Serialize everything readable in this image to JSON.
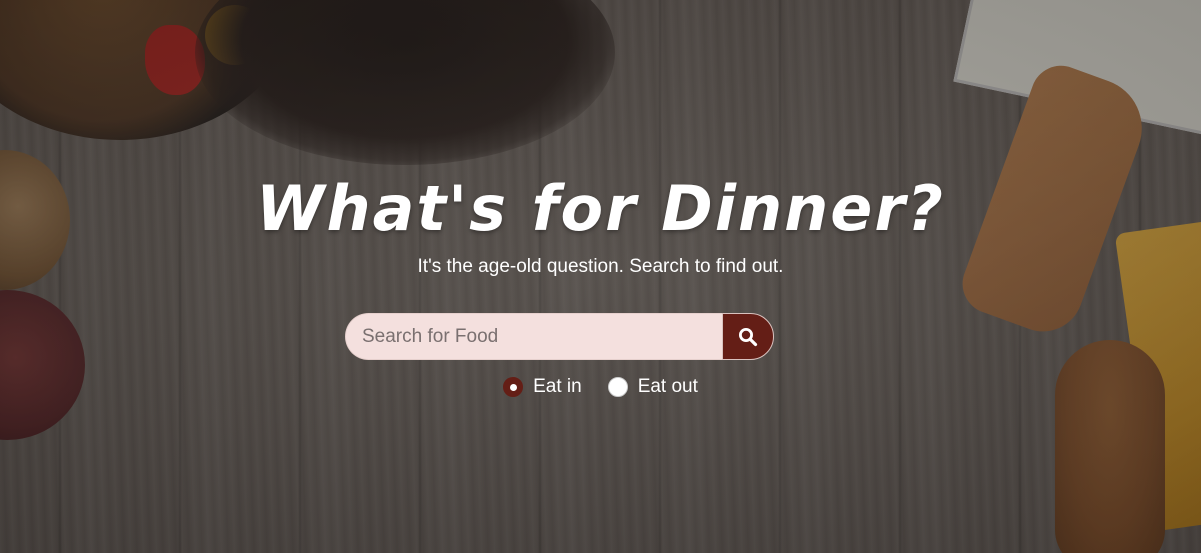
{
  "hero": {
    "title": "What's for Dinner?",
    "subtitle": "It's the age-old question. Search to find out."
  },
  "search": {
    "placeholder": "Search for Food",
    "value": "",
    "button_icon": "search-icon"
  },
  "options": {
    "eat_in_label": "Eat in",
    "eat_out_label": "Eat out",
    "selected": "Eat in"
  },
  "colors": {
    "accent": "#641e16",
    "input_bg": "#f4e0de",
    "text": "#ffffff"
  }
}
